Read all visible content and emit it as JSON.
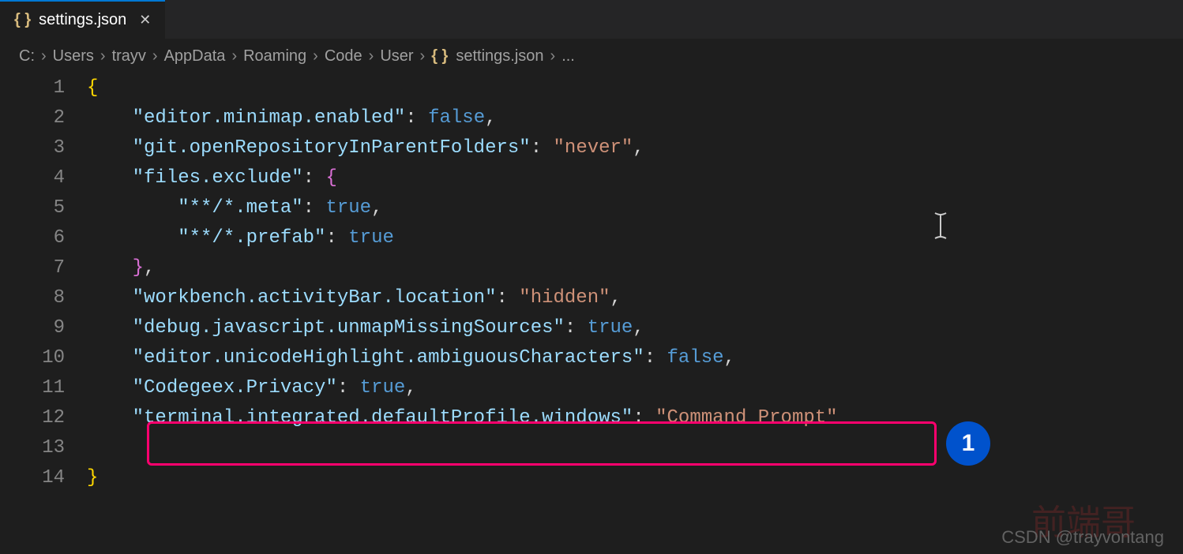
{
  "tab": {
    "filename": "settings.json",
    "icon": "{ }"
  },
  "breadcrumb": {
    "parts": [
      "C:",
      "Users",
      "trayv",
      "AppData",
      "Roaming",
      "Code",
      "User"
    ],
    "file": "settings.json",
    "file_icon": "{ }",
    "trailing": "..."
  },
  "code": {
    "lines": [
      {
        "n": "1",
        "content": [
          {
            "t": "{",
            "c": "brace"
          }
        ]
      },
      {
        "n": "2",
        "indent": 1,
        "content": [
          {
            "t": "\"editor.minimap.enabled\"",
            "c": "key"
          },
          {
            "t": ": ",
            "c": "colon"
          },
          {
            "t": "false",
            "c": "boolean"
          },
          {
            "t": ",",
            "c": "comma"
          }
        ]
      },
      {
        "n": "3",
        "indent": 1,
        "content": [
          {
            "t": "\"git.openRepositoryInParentFolders\"",
            "c": "key"
          },
          {
            "t": ": ",
            "c": "colon"
          },
          {
            "t": "\"never\"",
            "c": "string"
          },
          {
            "t": ",",
            "c": "comma"
          }
        ]
      },
      {
        "n": "4",
        "indent": 1,
        "content": [
          {
            "t": "\"files.exclude\"",
            "c": "key"
          },
          {
            "t": ": ",
            "c": "colon"
          },
          {
            "t": "{",
            "c": "brace-pink"
          }
        ]
      },
      {
        "n": "5",
        "indent": 2,
        "content": [
          {
            "t": "\"**/*.meta\"",
            "c": "key"
          },
          {
            "t": ": ",
            "c": "colon"
          },
          {
            "t": "true",
            "c": "boolean"
          },
          {
            "t": ",",
            "c": "comma"
          }
        ]
      },
      {
        "n": "6",
        "indent": 2,
        "content": [
          {
            "t": "\"**/*.prefab\"",
            "c": "key"
          },
          {
            "t": ": ",
            "c": "colon"
          },
          {
            "t": "true",
            "c": "boolean"
          }
        ]
      },
      {
        "n": "7",
        "indent": 1,
        "content": [
          {
            "t": "}",
            "c": "brace-pink"
          },
          {
            "t": ",",
            "c": "comma"
          }
        ]
      },
      {
        "n": "8",
        "indent": 1,
        "content": [
          {
            "t": "\"workbench.activityBar.location\"",
            "c": "key"
          },
          {
            "t": ": ",
            "c": "colon"
          },
          {
            "t": "\"hidden\"",
            "c": "string"
          },
          {
            "t": ",",
            "c": "comma"
          }
        ]
      },
      {
        "n": "9",
        "indent": 1,
        "content": [
          {
            "t": "\"debug.javascript.unmapMissingSources\"",
            "c": "key"
          },
          {
            "t": ": ",
            "c": "colon"
          },
          {
            "t": "true",
            "c": "boolean"
          },
          {
            "t": ",",
            "c": "comma"
          }
        ]
      },
      {
        "n": "10",
        "indent": 1,
        "content": [
          {
            "t": "\"editor.unicodeHighlight.ambiguousCharacters\"",
            "c": "key"
          },
          {
            "t": ": ",
            "c": "colon"
          },
          {
            "t": "false",
            "c": "boolean"
          },
          {
            "t": ",",
            "c": "comma"
          }
        ]
      },
      {
        "n": "11",
        "indent": 1,
        "content": [
          {
            "t": "\"Codegeex.Privacy\"",
            "c": "key"
          },
          {
            "t": ": ",
            "c": "colon"
          },
          {
            "t": "true",
            "c": "boolean"
          },
          {
            "t": ",",
            "c": "comma"
          }
        ]
      },
      {
        "n": "12",
        "indent": 1,
        "content": [
          {
            "t": "\"terminal.integrated.defaultProfile.windows\"",
            "c": "key"
          },
          {
            "t": ": ",
            "c": "colon"
          },
          {
            "t": "\"Command Prompt\"",
            "c": "string"
          }
        ]
      },
      {
        "n": "13",
        "indent": 0,
        "content": []
      },
      {
        "n": "14",
        "content": [
          {
            "t": "}",
            "c": "brace"
          }
        ]
      }
    ]
  },
  "annotations": {
    "badge": "1",
    "watermark_cn": "前端哥",
    "watermark_en": "CSDN @trayvontang"
  }
}
